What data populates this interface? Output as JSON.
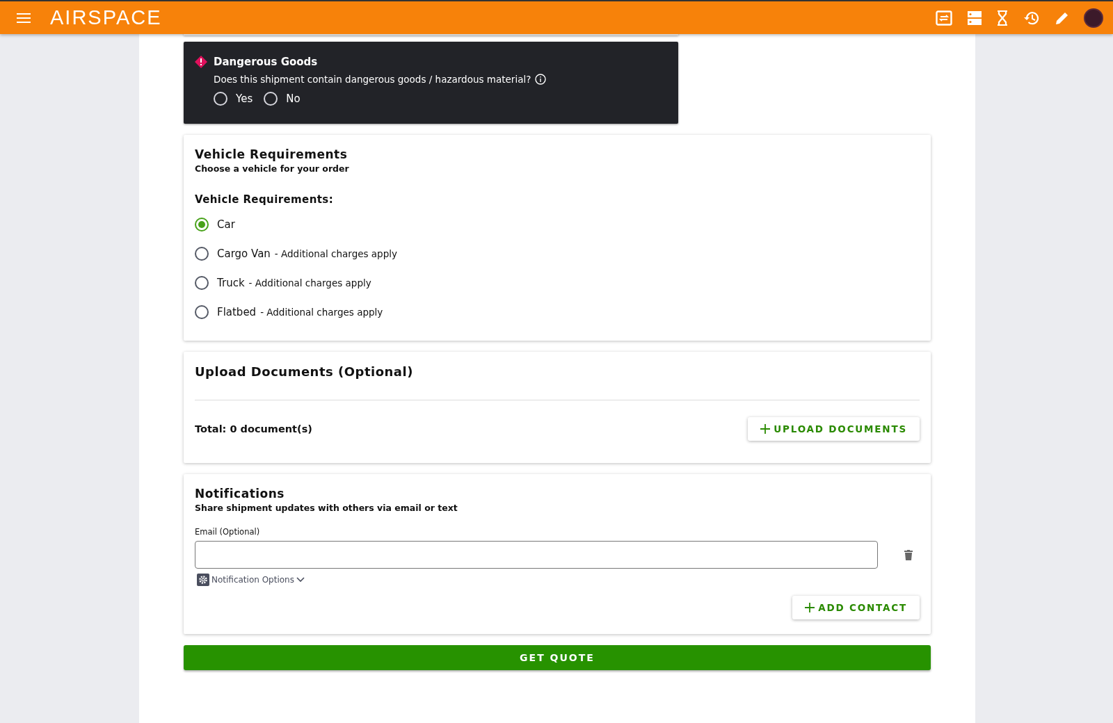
{
  "app_bar": {
    "logo": "AIRSPACE"
  },
  "dangerous_goods": {
    "title": "Dangerous Goods",
    "question": "Does this shipment contain dangerous goods / hazardous material?",
    "options": [
      {
        "label": "Yes",
        "selected": false
      },
      {
        "label": "No",
        "selected": false
      }
    ]
  },
  "vehicle": {
    "title": "Vehicle Requirements",
    "subtitle": "Choose a vehicle for your order",
    "label": "Vehicle Requirements:",
    "options": [
      {
        "label": "Car",
        "selected": true
      },
      {
        "label": "Cargo Van",
        "note": "- Additional charges apply",
        "selected": false
      },
      {
        "label": "Truck",
        "note": "- Additional charges apply",
        "selected": false
      },
      {
        "label": "Flatbed",
        "note": "- Additional charges apply",
        "selected": false
      }
    ]
  },
  "upload": {
    "title": "Upload Documents (Optional)",
    "total": "Total: 0 document(s)",
    "button": "UPLOAD DOCUMENTS"
  },
  "notifications": {
    "title": "Notifications",
    "subtitle": "Share shipment updates with others via email or text",
    "email_label": "Email (Optional)",
    "options_label": "Notification Options",
    "button": "ADD CONTACT"
  },
  "submit": "GET QUOTE"
}
